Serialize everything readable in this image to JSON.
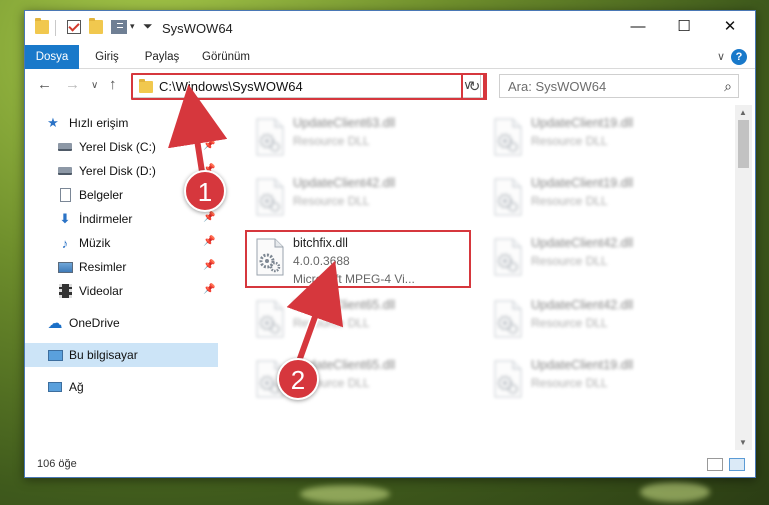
{
  "window": {
    "title": "SysWOW64",
    "minimize_glyph": "—",
    "maximize_glyph": "☐",
    "close_glyph": "✕"
  },
  "ribbon": {
    "tabs": [
      "Dosya",
      "Giriş",
      "Paylaş",
      "Görünüm"
    ],
    "help_glyph": "?"
  },
  "nav": {
    "address": "C:\\Windows\\SysWOW64",
    "search_placeholder": "Ara: SysWOW64"
  },
  "sidebar": {
    "items": [
      {
        "label": "Hızlı erişim",
        "icon": "star-icon"
      },
      {
        "label": "Yerel Disk (C:)",
        "icon": "drive-icon",
        "pinned": true
      },
      {
        "label": "Yerel Disk (D:)",
        "icon": "drive-icon",
        "pinned": true
      },
      {
        "label": "Belgeler",
        "icon": "documents-icon",
        "pinned": true
      },
      {
        "label": "İndirmeler",
        "icon": "download-icon",
        "pinned": true
      },
      {
        "label": "Müzik",
        "icon": "music-icon",
        "pinned": true
      },
      {
        "label": "Resimler",
        "icon": "pictures-icon",
        "pinned": true
      },
      {
        "label": "Videolar",
        "icon": "video-icon",
        "pinned": true
      },
      {
        "label": "OneDrive",
        "icon": "cloud-icon"
      },
      {
        "label": "Bu bilgisayar",
        "icon": "computer-icon",
        "selected": true
      },
      {
        "label": "Ağ",
        "icon": "network-icon"
      }
    ]
  },
  "files": {
    "highlighted": {
      "name": "bitchfix.dll",
      "version": "4.0.0.3688",
      "description": "Microsoft MPEG-4 Vi..."
    },
    "blurred": [
      {
        "name": "UpdateClient63.dll",
        "desc": "Resource DLL"
      },
      {
        "name": "UpdateClient19.dll",
        "desc": "Resource DLL"
      },
      {
        "name": "UpdateClient42.dll",
        "desc": "Resource DLL"
      },
      {
        "name": "UpdateClient19.dll",
        "desc": "Resource DLL"
      },
      {
        "name": "UpdateClient42.dll",
        "desc": "Resource DLL"
      },
      {
        "name": "UpdateClient65.dll",
        "desc": "Resource DLL"
      },
      {
        "name": "UpdateClient42.dll",
        "desc": "Resource DLL"
      },
      {
        "name": "UpdateClient65.dll",
        "desc": "Resource DLL"
      },
      {
        "name": "UpdateClient19.dll",
        "desc": "Resource DLL"
      }
    ]
  },
  "status": {
    "item_count": "106 öğe"
  },
  "callouts": {
    "one": "1",
    "two": "2"
  },
  "colors": {
    "accent": "#1979ca",
    "highlight": "#d6373d",
    "selected_bg": "#cce4f7"
  }
}
